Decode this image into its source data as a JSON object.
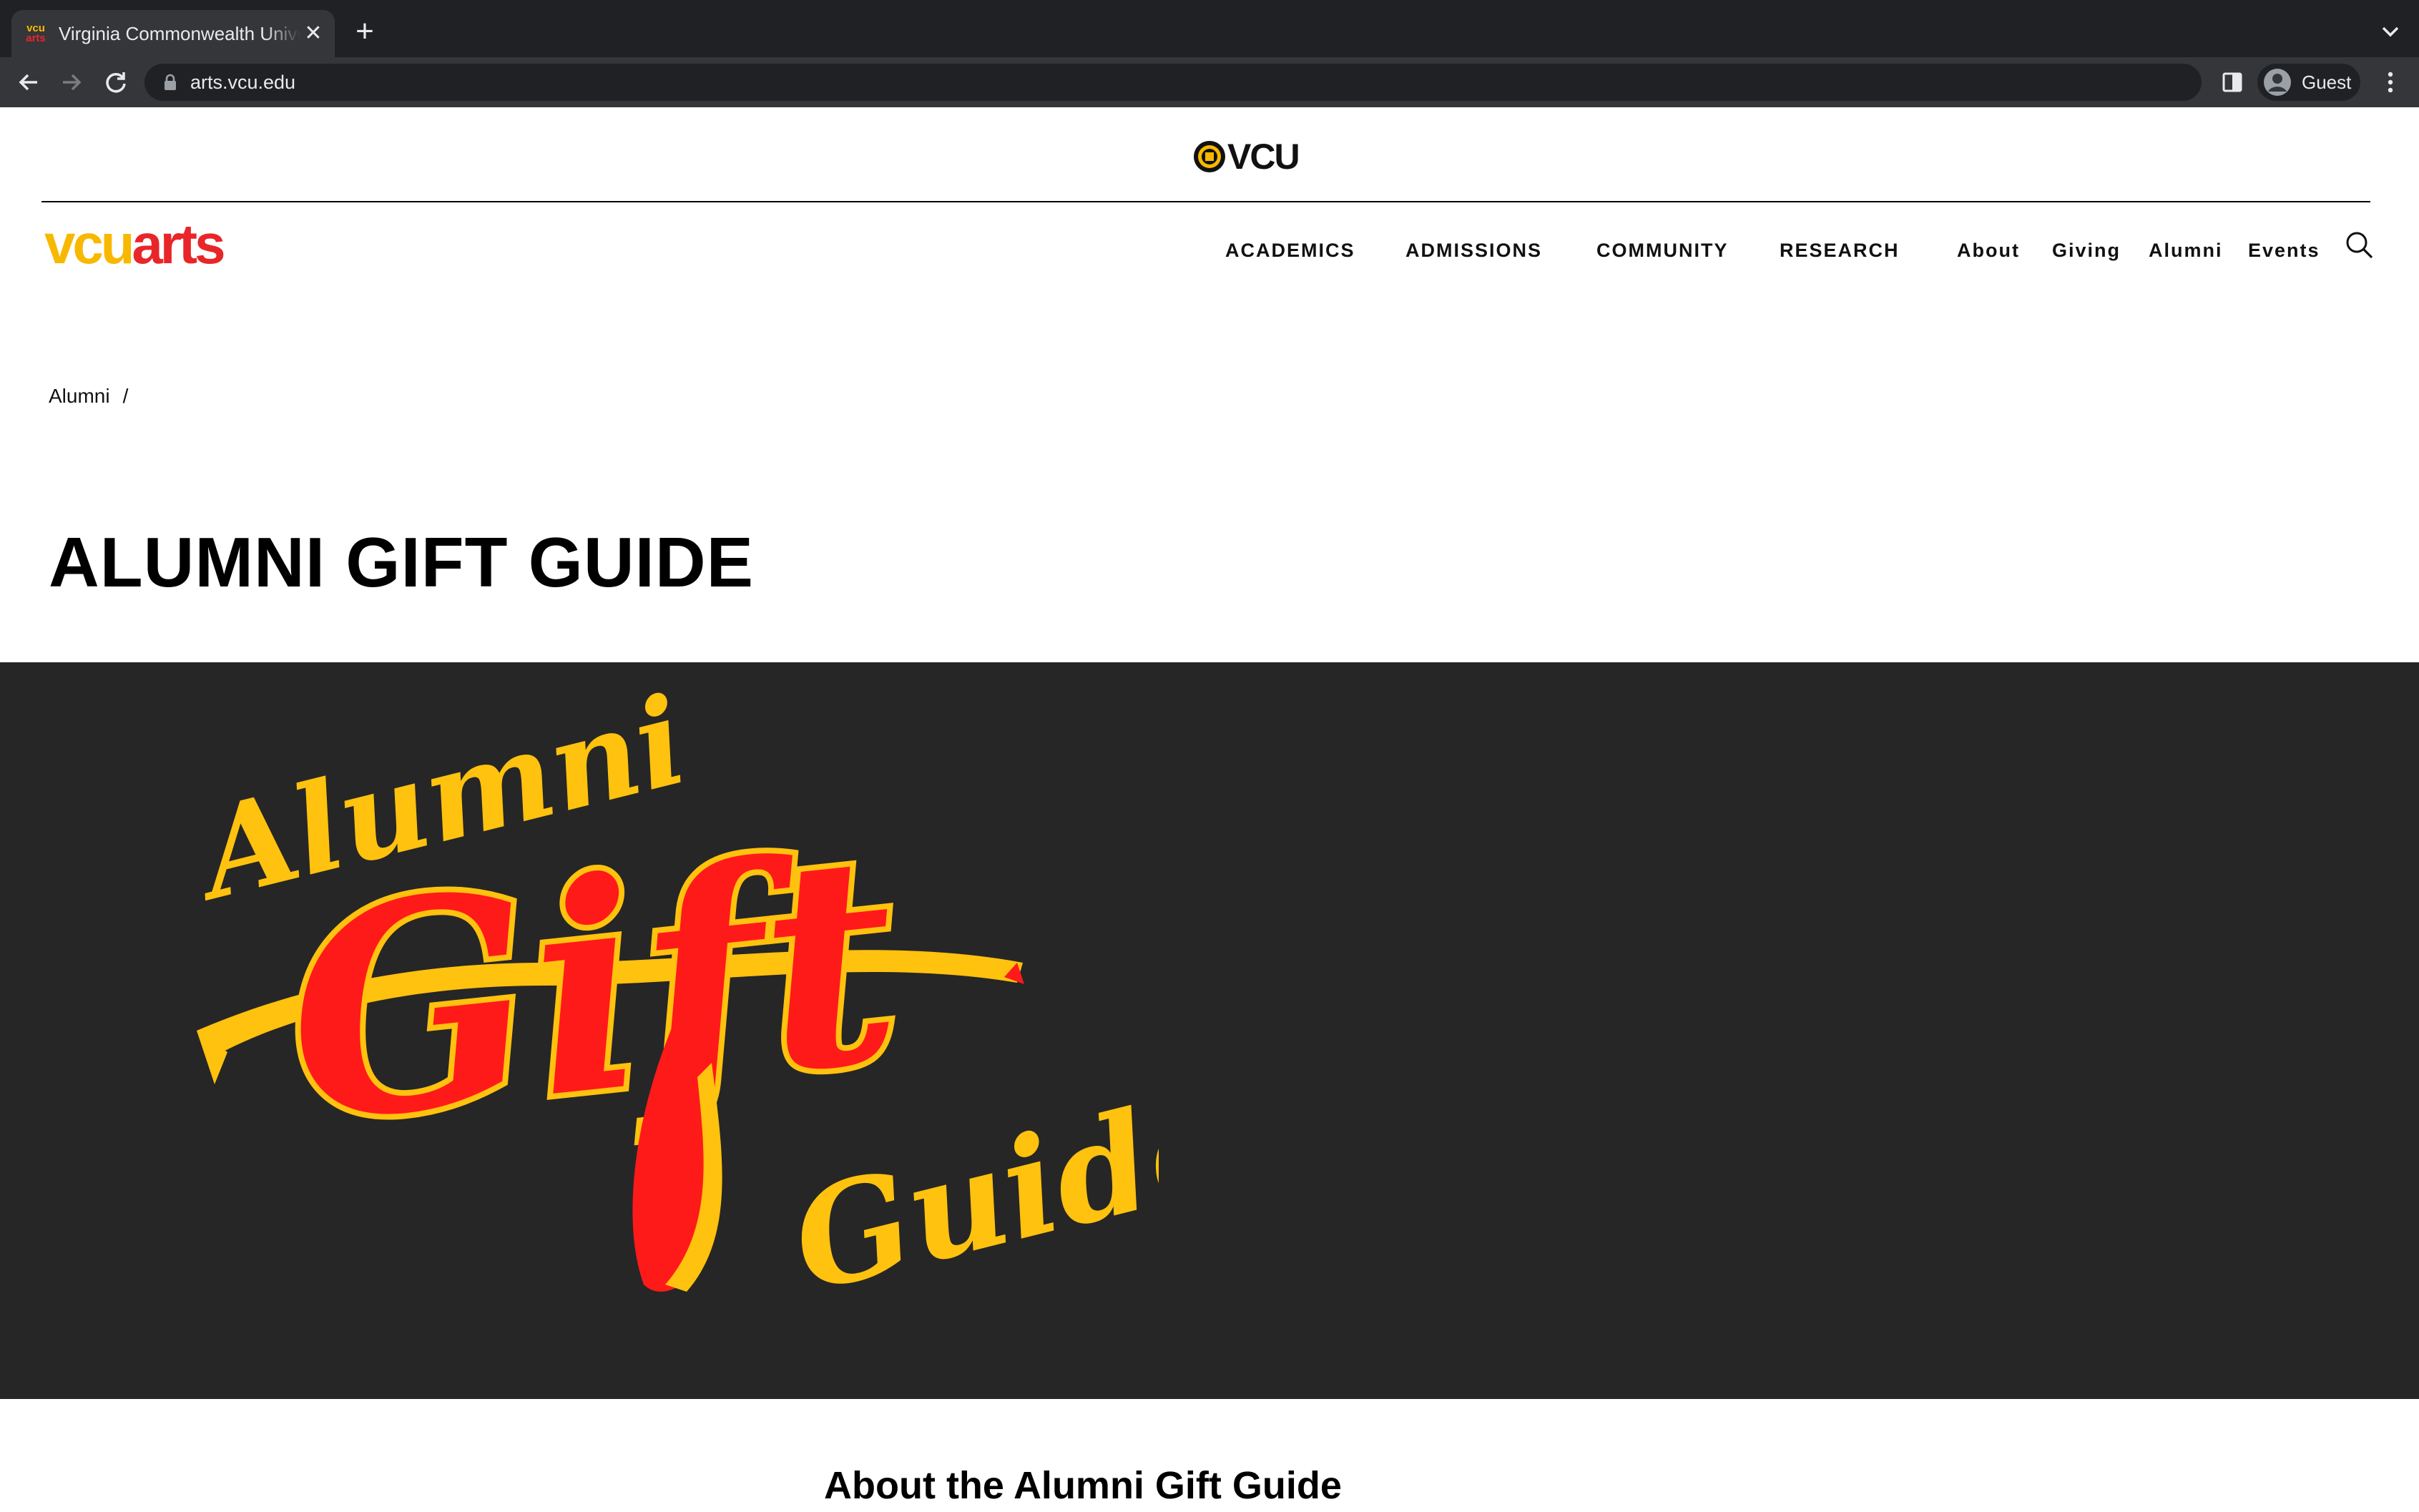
{
  "browser": {
    "tab_title": "Virginia Commonwealth University",
    "favicon_top": "vcu",
    "favicon_bottom": "arts",
    "url": "arts.vcu.edu",
    "profile_label": "Guest"
  },
  "site": {
    "top_logo": "VCU",
    "logo_vcu": "vcu",
    "logo_arts": "arts",
    "main_nav": [
      "ACADEMICS",
      "ADMISSIONS",
      "COMMUNITY",
      "RESEARCH"
    ],
    "utility_nav": [
      "About",
      "Giving",
      "Alumni",
      "Events"
    ]
  },
  "breadcrumb": {
    "items": [
      "Alumni"
    ],
    "separator": "/"
  },
  "page_title": "ALUMNI GIFT GUIDE",
  "hero": {
    "line1": "Alumni",
    "line2": "Gift",
    "line3": "Guide",
    "colors": {
      "background": "#262626",
      "gold": "#ffc20e",
      "red": "#ff1a1a"
    }
  },
  "section_heading": "About the Alumni Gift Guide"
}
